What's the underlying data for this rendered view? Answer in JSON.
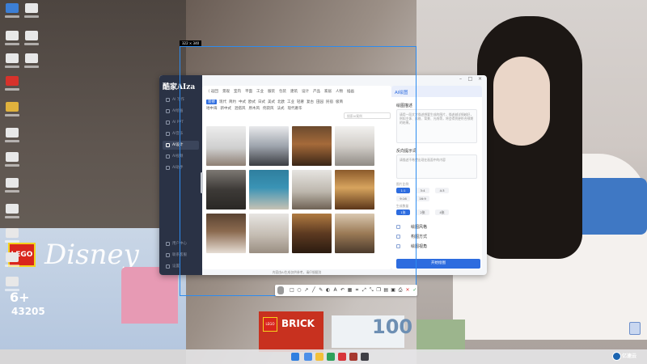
{
  "screenshot_tool": {
    "size_label": "322 × 340",
    "toolbar_icons": [
      "rectangle-icon",
      "ellipse-icon",
      "arrow-icon",
      "line-icon",
      "pen-icon",
      "marker-icon",
      "text-icon",
      "undo-icon",
      "mosaic-icon",
      "crop-icon",
      "expand-icon",
      "shrink-icon",
      "copy-icon",
      "pin-icon",
      "save-icon",
      "ocr-icon",
      "close-icon",
      "confirm-icon"
    ]
  },
  "app": {
    "logo_cn": "酷家",
    "logo_en": "AIza",
    "sidebar": {
      "items": [
        {
          "label": "AI 写作",
          "active": false
        },
        {
          "label": "AI绘画",
          "active": false
        },
        {
          "label": "AI PPT",
          "active": false
        },
        {
          "label": "AI音乐",
          "active": false
        },
        {
          "label": "AI设计",
          "active": true
        },
        {
          "label": "AI视频",
          "active": false
        },
        {
          "label": "AI助手",
          "active": false
        }
      ],
      "bottom_items": [
        {
          "label": "用户中心"
        },
        {
          "label": "联系客服"
        },
        {
          "label": "设置"
        }
      ]
    },
    "main": {
      "breadcrumb": "〈  返回",
      "top_tabs": [
        "景观",
        "室内",
        "平面",
        "工业",
        "服装",
        "包装",
        "建筑",
        "设计",
        "产品",
        "家居",
        "人物",
        "插画"
      ],
      "category_row1": [
        "装修",
        "现代",
        "简约",
        "中式",
        "欧式",
        "日式",
        "美式",
        "北欧",
        "工业",
        "轻奢",
        "复古",
        "田园",
        "民宿",
        "极简"
      ],
      "category_row2": [
        "地中海",
        "新中式",
        "混搭风",
        "原木风",
        "侘寂风",
        "法式",
        "现代奢华"
      ],
      "search_placeholder": "搜索AI案例",
      "disclaimer": "内容由AI生成仅供参考，请仔细甄别"
    },
    "right_panel": {
      "title": "AI绘图",
      "section1_title": "绘图描述",
      "section1_desc": "请用一段文字描述想要生成的图片，描述越详细越好，例如主体、风格、背景、光线等，将会得到更符合预期的结果。",
      "section2_title": "反向提示词",
      "section2_placeholder": "请描述不希望出现在画面中的内容",
      "ratio_label": "图片比例",
      "ratios": [
        {
          "label": "1:1",
          "selected": true
        },
        {
          "label": "3:4",
          "selected": false
        },
        {
          "label": "4:3",
          "selected": false
        },
        {
          "label": "9:16",
          "selected": false
        },
        {
          "label": "16:9",
          "selected": false
        }
      ],
      "count_label": "生成数量",
      "counts": [
        {
          "label": "1张",
          "selected": true
        },
        {
          "label": "2张",
          "selected": false
        },
        {
          "label": "4张",
          "selected": false
        }
      ],
      "options": [
        {
          "label": "绘图风格"
        },
        {
          "label": "构图方式"
        },
        {
          "label": "绘图视角"
        }
      ],
      "generate_label": "开始绘图"
    }
  },
  "wallpaper": {
    "lego_logo": "LEGO",
    "disney": "Disney",
    "age": "6+",
    "set_number": "43205",
    "bricks": "BRICK",
    "box_number": "100"
  },
  "watermark": "亿速云"
}
